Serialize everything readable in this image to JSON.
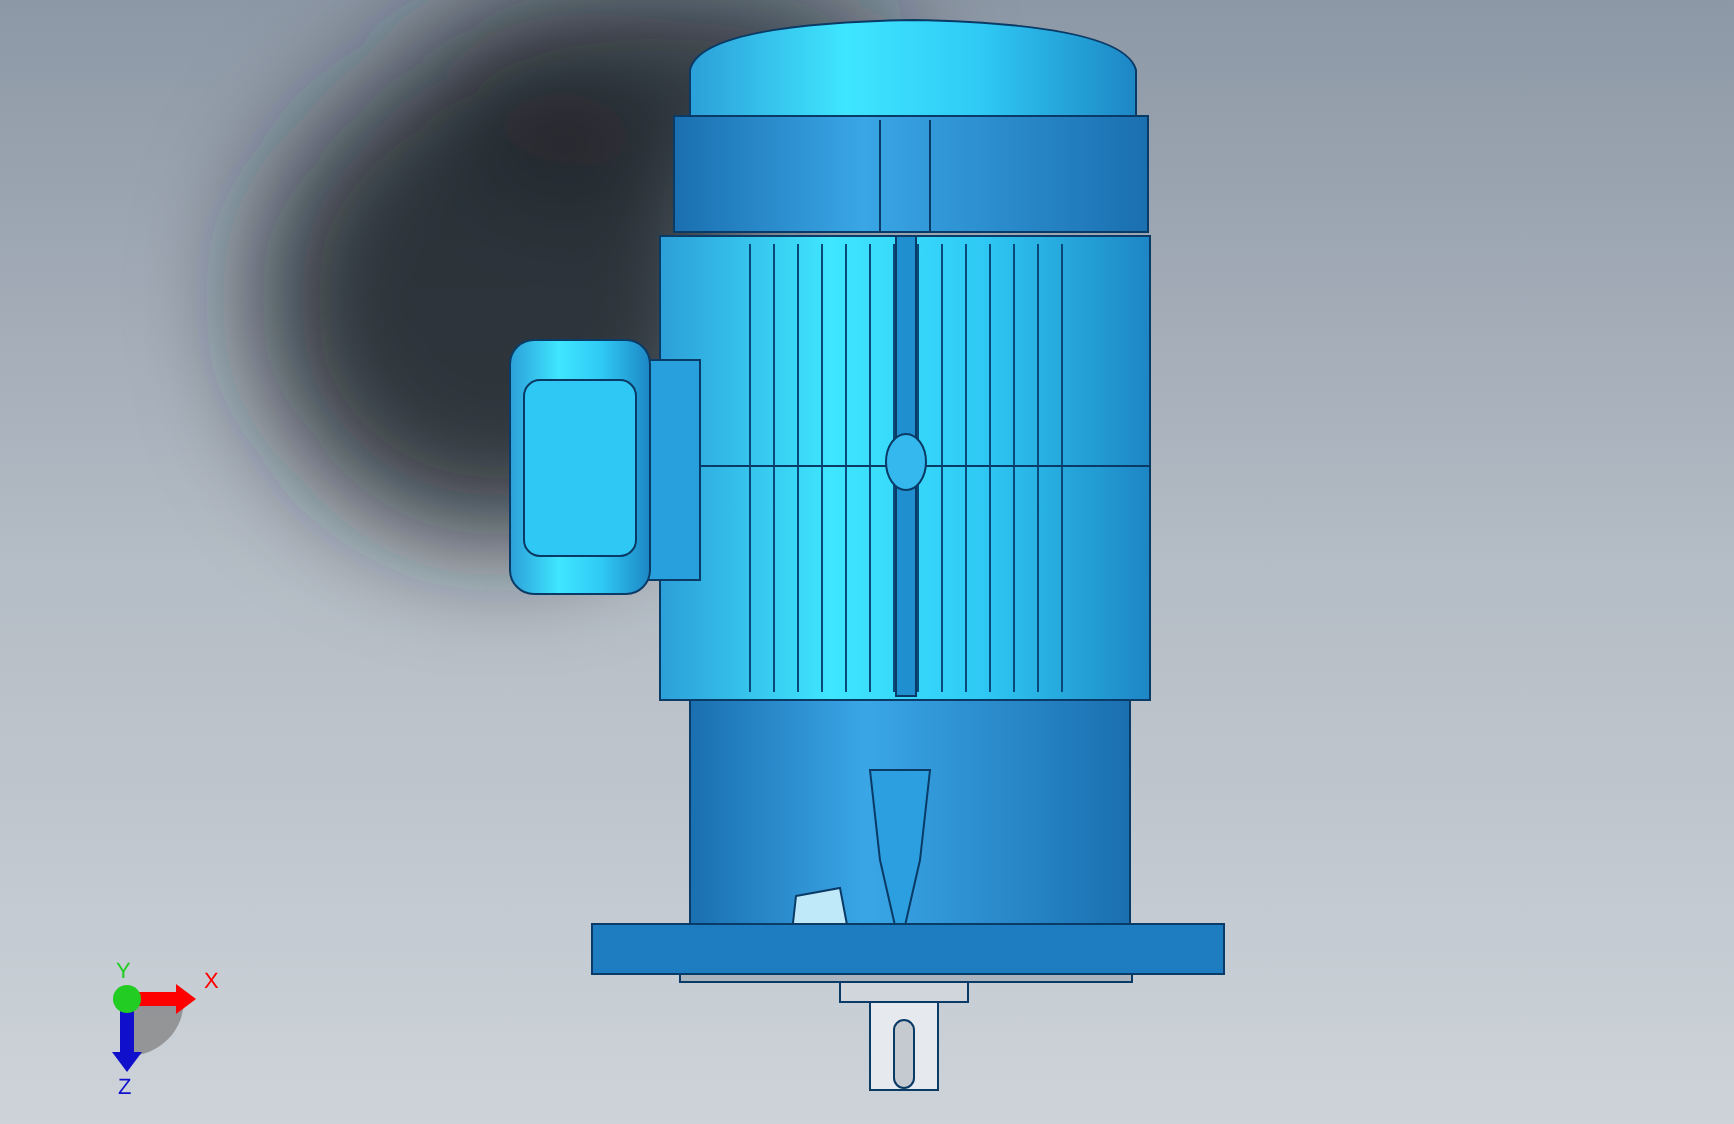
{
  "viewport": {
    "triad": {
      "axes": [
        {
          "label": "X",
          "color": "#ff0000"
        },
        {
          "label": "Y",
          "color": "#22cc22"
        },
        {
          "label": "Z",
          "color": "#1010cc"
        }
      ]
    }
  }
}
